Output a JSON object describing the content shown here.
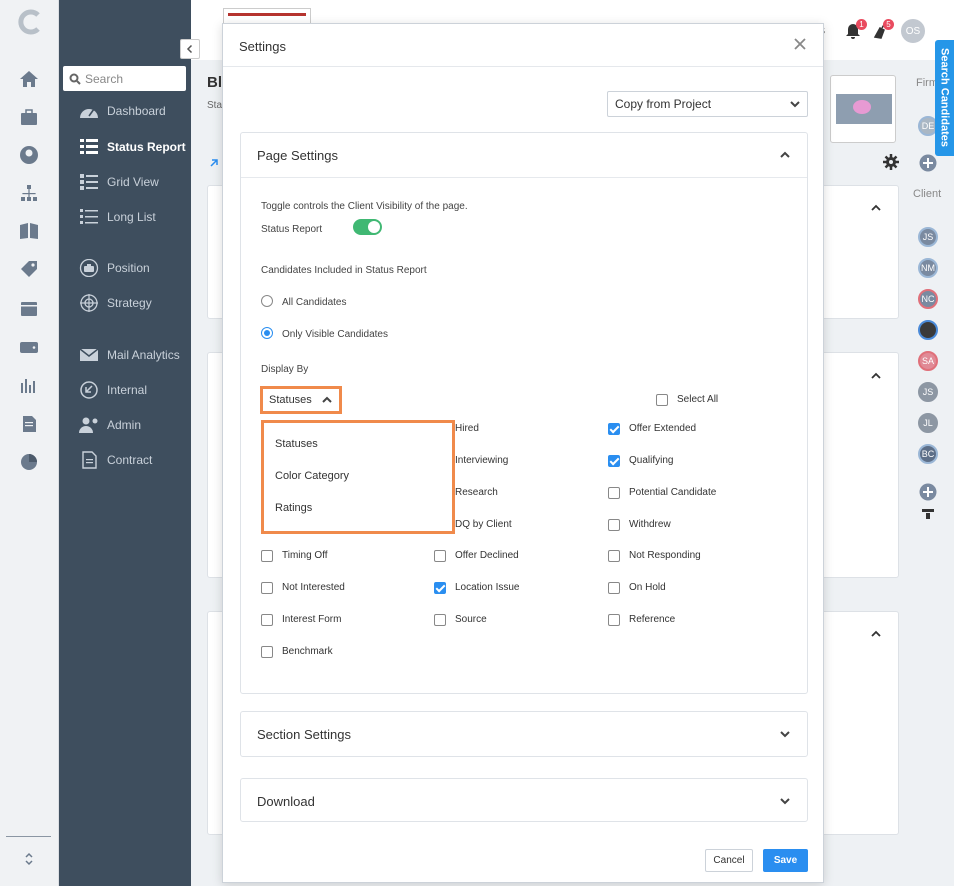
{
  "nav": {
    "search_placeholder": "Search",
    "items": [
      {
        "label": "Dashboard",
        "icon": "dashboard-icon"
      },
      {
        "label": "Status Report",
        "icon": "status-report-icon",
        "active": true
      },
      {
        "label": "Grid View",
        "icon": "grid-view-icon"
      },
      {
        "label": "Long List",
        "icon": "long-list-icon"
      },
      {
        "label": "Position",
        "icon": "briefcase-icon"
      },
      {
        "label": "Strategy",
        "icon": "target-icon"
      },
      {
        "label": "Mail Analytics",
        "icon": "mail-icon"
      },
      {
        "label": "Internal",
        "icon": "arrow-circle-icon"
      },
      {
        "label": "Admin",
        "icon": "user-gear-icon"
      },
      {
        "label": "Contract",
        "icon": "contract-icon"
      }
    ]
  },
  "topbar": {
    "notif_count": "1",
    "tasks_count": "5",
    "user_initials": "OS",
    "tasks_suffix": "ks"
  },
  "bg": {
    "title_fragment": "Bl",
    "sub_fragment": "Sta",
    "firm_label": "Firm",
    "client_label": "Client",
    "firm_avatar": "DE",
    "client_avatars": [
      "JS",
      "NM",
      "NC",
      "",
      "SA",
      "JS",
      "JL",
      "BC"
    ],
    "search_candidates": "Search Candidates"
  },
  "modal": {
    "title": "Settings",
    "copy_from_project": "Copy from Project",
    "page_settings": {
      "title": "Page Settings",
      "toggle_hint": "Toggle controls the Client Visibility of the page.",
      "status_report_label": "Status Report",
      "candidates_label": "Candidates Included in Status Report",
      "radio_all": "All Candidates",
      "radio_visible": "Only Visible Candidates",
      "display_by_label": "Display By",
      "display_by_value": "Statuses",
      "select_all": "Select All",
      "dropdown_options": [
        "Statuses",
        "Color Category",
        "Ratings"
      ],
      "statuses": {
        "col2": [
          {
            "label": "Hired",
            "checked": false
          },
          {
            "label": "Interviewing",
            "checked": false
          },
          {
            "label": "Research",
            "checked": false
          },
          {
            "label": "DQ by Client",
            "checked": false
          },
          {
            "label": "Offer Declined",
            "checked": false
          },
          {
            "label": "Location Issue",
            "checked": true
          },
          {
            "label": "Source",
            "checked": false
          }
        ],
        "col3": [
          {
            "label": "Offer Extended",
            "checked": true
          },
          {
            "label": "Qualifying",
            "checked": true
          },
          {
            "label": "Potential Candidate",
            "checked": false
          },
          {
            "label": "Withdrew",
            "checked": false
          },
          {
            "label": "Not Responding",
            "checked": false
          },
          {
            "label": "On Hold",
            "checked": false
          },
          {
            "label": "Reference",
            "checked": false
          }
        ],
        "col1": [
          {
            "label": "Timing Off",
            "checked": false
          },
          {
            "label": "Not Interested",
            "checked": false
          },
          {
            "label": "Interest Form",
            "checked": false
          },
          {
            "label": "Benchmark",
            "checked": false
          }
        ]
      }
    },
    "section_settings": "Section Settings",
    "download": "Download",
    "cancel": "Cancel",
    "save": "Save"
  },
  "colors": {
    "accent": "#2a8ef0",
    "highlight": "#f08a4b",
    "toggle_on": "#40b873",
    "nav_bg": "#3e4e5e"
  }
}
